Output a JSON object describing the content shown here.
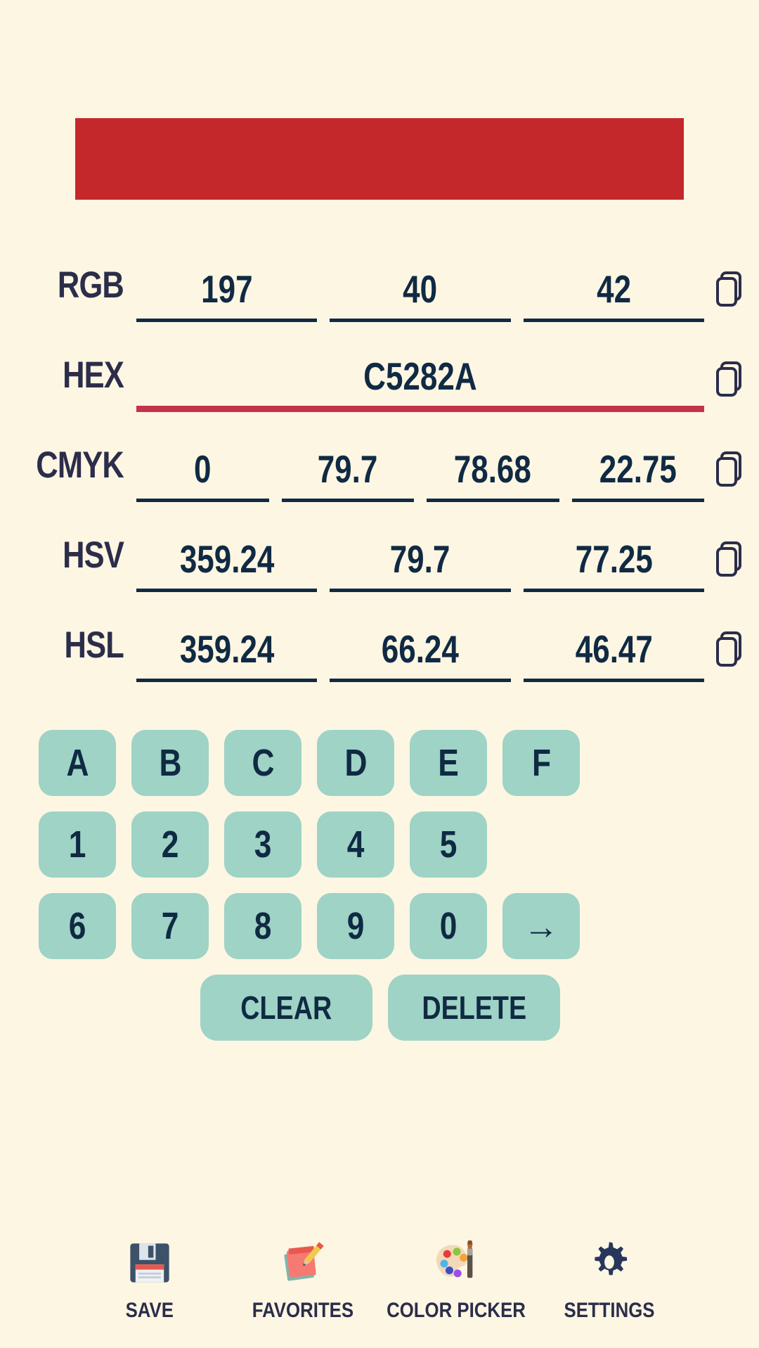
{
  "swatch": {
    "color": "#C5282A"
  },
  "theme": {
    "background": "#FDF6E3",
    "text_dark": "#102A43",
    "label_dark": "#2B2D4A",
    "key_fill": "#9ED3C6",
    "active_underline": "#C5334A"
  },
  "color_rows": [
    {
      "label": "RGB",
      "values": [
        "197",
        "40",
        "42"
      ],
      "active": false,
      "copy_icon": "copy-icon"
    },
    {
      "label": "HEX",
      "values": [
        "C5282A"
      ],
      "active": true,
      "copy_icon": "copy-icon"
    },
    {
      "label": "CMYK",
      "values": [
        "0",
        "79.7",
        "78.68",
        "22.75"
      ],
      "active": false,
      "copy_icon": "copy-icon"
    },
    {
      "label": "HSV",
      "values": [
        "359.24",
        "79.7",
        "77.25"
      ],
      "active": false,
      "copy_icon": "copy-icon"
    },
    {
      "label": "HSL",
      "values": [
        "359.24",
        "66.24",
        "46.47"
      ],
      "active": false,
      "copy_icon": "copy-icon"
    }
  ],
  "keypad": {
    "rows": [
      [
        "A",
        "B",
        "C",
        "D",
        "E",
        "F"
      ],
      [
        "1",
        "2",
        "3",
        "4",
        "5"
      ],
      [
        "6",
        "7",
        "8",
        "9",
        "0",
        "→"
      ]
    ],
    "arrow_label": "→",
    "clear_label": "CLEAR",
    "delete_label": "DELETE"
  },
  "bottom_nav": [
    {
      "label": "SAVE",
      "icon": "floppy-disk-icon"
    },
    {
      "label": "FAVORITES",
      "icon": "notepad-pencil-icon"
    },
    {
      "label": "COLOR PICKER",
      "icon": "palette-brush-icon"
    },
    {
      "label": "SETTINGS",
      "icon": "gear-icon"
    }
  ]
}
